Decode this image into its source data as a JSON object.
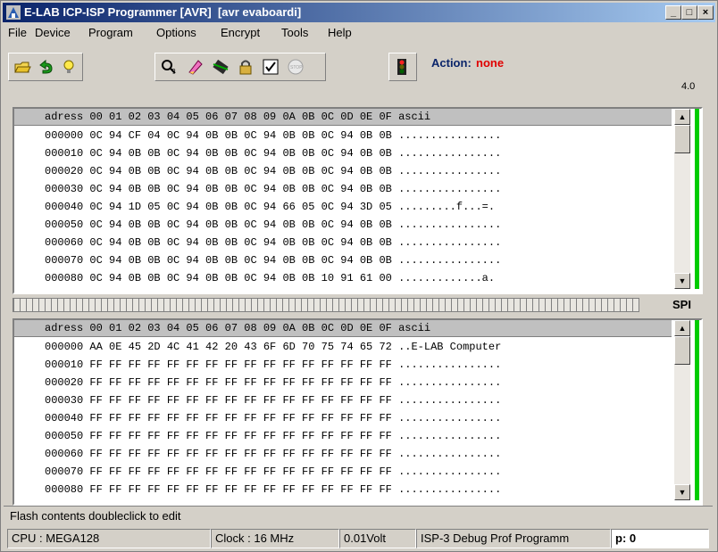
{
  "window": {
    "title": "E-LAB ICP-ISP Programmer [AVR]  [avr evaboardi]",
    "minimize": "_",
    "maximize": "□",
    "close": "×"
  },
  "menu": [
    "File",
    "Device",
    "Program",
    "Options",
    "Encrypt",
    "Tools",
    "Help"
  ],
  "toolbar": {
    "action_label": "Action:",
    "action_value": "none",
    "version": "4.0",
    "buttons": [
      "open-icon",
      "undo-icon",
      "bulb-icon",
      "search-help-icon",
      "erase-icon",
      "chip-icon",
      "lock-icon",
      "verify-icon",
      "stop-icon",
      "traffic-light-icon"
    ]
  },
  "flash_panel": {
    "header": "adress 00 01 02 03 04 05 06 07 08 09 0A 0B 0C 0D 0E 0F ascii",
    "rows": [
      "000000 0C 94 CF 04 0C 94 0B 0B 0C 94 0B 0B 0C 94 0B 0B ................",
      "000010 0C 94 0B 0B 0C 94 0B 0B 0C 94 0B 0B 0C 94 0B 0B ................",
      "000020 0C 94 0B 0B 0C 94 0B 0B 0C 94 0B 0B 0C 94 0B 0B ................",
      "000030 0C 94 0B 0B 0C 94 0B 0B 0C 94 0B 0B 0C 94 0B 0B ................",
      "000040 0C 94 1D 05 0C 94 0B 0B 0C 94 66 05 0C 94 3D 05 .........f...=.",
      "000050 0C 94 0B 0B 0C 94 0B 0B 0C 94 0B 0B 0C 94 0B 0B ................",
      "000060 0C 94 0B 0B 0C 94 0B 0B 0C 94 0B 0B 0C 94 0B 0B ................",
      "000070 0C 94 0B 0B 0C 94 0B 0B 0C 94 0B 0B 0C 94 0B 0B ................",
      "000080 0C 94 0B 0B 0C 94 0B 0B 0C 94 0B 0B 10 91 61 00 .............a."
    ]
  },
  "spi_label": "SPI",
  "eeprom_panel": {
    "header": "adress 00 01 02 03 04 05 06 07 08 09 0A 0B 0C 0D 0E 0F ascii",
    "rows": [
      "000000 AA 0E 45 2D 4C 41 42 20 43 6F 6D 70 75 74 65 72 ..E-LAB Computer",
      "000010 FF FF FF FF FF FF FF FF FF FF FF FF FF FF FF FF ................",
      "000020 FF FF FF FF FF FF FF FF FF FF FF FF FF FF FF FF ................",
      "000030 FF FF FF FF FF FF FF FF FF FF FF FF FF FF FF FF ................",
      "000040 FF FF FF FF FF FF FF FF FF FF FF FF FF FF FF FF ................",
      "000050 FF FF FF FF FF FF FF FF FF FF FF FF FF FF FF FF ................",
      "000060 FF FF FF FF FF FF FF FF FF FF FF FF FF FF FF FF ................",
      "000070 FF FF FF FF FF FF FF FF FF FF FF FF FF FF FF FF ................",
      "000080 FF FF FF FF FF FF FF FF FF FF FF FF FF FF FF FF ................"
    ]
  },
  "status": {
    "hint": "Flash contents doubleclick to edit",
    "cpu": "CPU : MEGA128",
    "clock": "Clock : 16 MHz",
    "volt": "0.01Volt",
    "programmer": "ISP-3 Debug Prof Programm",
    "p": "p: 0"
  },
  "colors": {
    "accent_green": "#00cc00",
    "action_red": "#e00000",
    "title_blue": "#0a246a"
  }
}
